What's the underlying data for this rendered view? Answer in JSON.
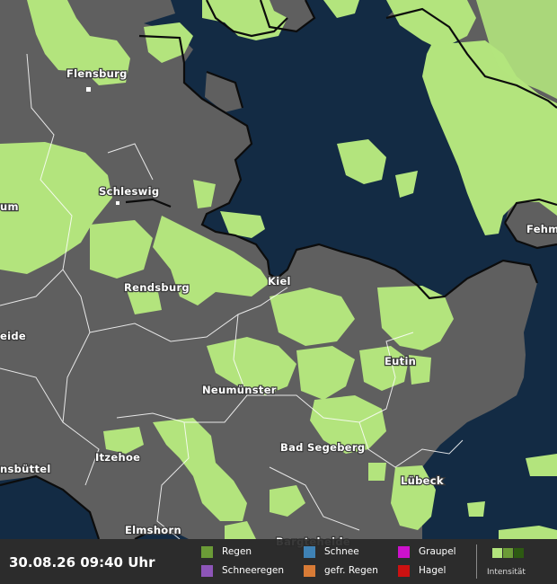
{
  "map": {
    "colors": {
      "land": "#5f5f5f",
      "sea": "#132b44",
      "rain": "#b3e47d",
      "admin_border": "#ffffff",
      "coast": "#0c0c0c"
    },
    "cities": [
      {
        "name": "Flensburg"
      },
      {
        "name": "Schleswig"
      },
      {
        "name": "Rendsburg"
      },
      {
        "name": "Kiel"
      },
      {
        "name": "Eutin"
      },
      {
        "name": "Neumünster"
      },
      {
        "name": "Bad Segeberg"
      },
      {
        "name": "Itzehoe"
      },
      {
        "name": "Lübeck"
      },
      {
        "name": "Elmshorn"
      },
      {
        "name": "Bargteheide"
      },
      {
        "name": "Fehm"
      },
      {
        "name": "um"
      },
      {
        "name": "eide"
      },
      {
        "name": "nsbüttel"
      }
    ]
  },
  "legend": {
    "timestamp": "30.08.26 09:40 Uhr",
    "items": [
      {
        "label": "Regen",
        "color": "#6b9b37",
        "icon": "rain-swatch"
      },
      {
        "label": "Schneeregen",
        "color": "#8d55b8",
        "icon": "sleet-swatch"
      },
      {
        "label": "Schnee",
        "color": "#3f82b5",
        "icon": "snow-swatch"
      },
      {
        "label": "gefr. Regen",
        "color": "#d87b36",
        "icon": "freezing-rain-swatch"
      },
      {
        "label": "Graupel",
        "color": "#cc11cc",
        "icon": "graupel-swatch"
      },
      {
        "label": "Hagel",
        "color": "#cc1111",
        "icon": "hail-swatch"
      }
    ],
    "intensity": {
      "label": "Intensität",
      "colors": [
        "#b3e47d",
        "#6b9b37",
        "#2d5a12"
      ]
    }
  }
}
